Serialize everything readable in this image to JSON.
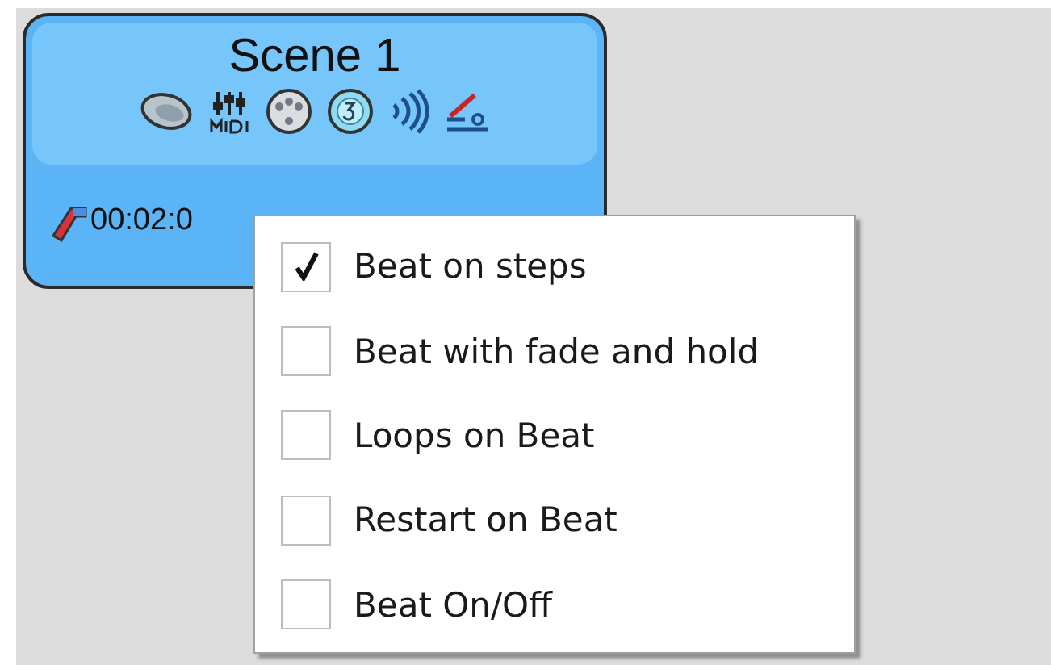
{
  "scene_card": {
    "title": "Scene 1",
    "duration": "00:02:0"
  },
  "context_menu": {
    "items": [
      {
        "label": "Beat on steps",
        "checked": true
      },
      {
        "label": "Beat with fade and hold",
        "checked": false
      },
      {
        "label": "Loops on Beat",
        "checked": false
      },
      {
        "label": "Restart on Beat",
        "checked": false
      },
      {
        "label": "Beat On/Off",
        "checked": false
      }
    ]
  }
}
